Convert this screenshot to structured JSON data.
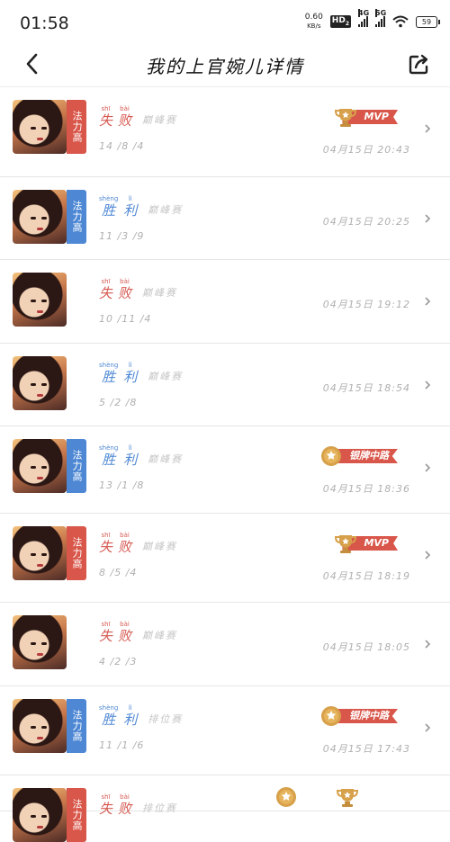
{
  "status_bar": {
    "time": "01:58",
    "net_speed_value": "0.60",
    "net_speed_unit": "KB/s",
    "hd": "HD",
    "hd_sub": "2",
    "sig1": "4G",
    "sig2": "5G",
    "battery": "59"
  },
  "nav": {
    "title": "我的上官婉儿详情"
  },
  "rows": [
    {
      "hero_tag": "法力高",
      "tag_color": "red",
      "result": [
        "失",
        "败"
      ],
      "result_py": [
        "shī",
        "bài"
      ],
      "result_type": "loss",
      "mode": "巅峰赛",
      "kda": "14 /8 /4",
      "time": "04月15日 20:43",
      "badge": "MVP",
      "badge_kind": "mvp"
    },
    {
      "hero_tag": "法力高",
      "tag_color": "blue",
      "result": [
        "胜",
        "利"
      ],
      "result_py": [
        "shèng",
        "lì"
      ],
      "result_type": "win",
      "mode": "巅峰赛",
      "kda": "11 /3 /9",
      "time": "04月15日 20:25",
      "badge": "",
      "badge_kind": ""
    },
    {
      "hero_tag": "",
      "tag_color": "",
      "result": [
        "失",
        "败"
      ],
      "result_py": [
        "shī",
        "bài"
      ],
      "result_type": "loss",
      "mode": "巅峰赛",
      "kda": "10 /11 /4",
      "time": "04月15日 19:12",
      "badge": "",
      "badge_kind": ""
    },
    {
      "hero_tag": "",
      "tag_color": "",
      "result": [
        "胜",
        "利"
      ],
      "result_py": [
        "shèng",
        "lì"
      ],
      "result_type": "win",
      "mode": "巅峰赛",
      "kda": "5 /2 /8",
      "time": "04月15日 18:54",
      "badge": "",
      "badge_kind": ""
    },
    {
      "hero_tag": "法力高",
      "tag_color": "blue",
      "result": [
        "胜",
        "利"
      ],
      "result_py": [
        "shèng",
        "lì"
      ],
      "result_type": "win",
      "mode": "巅峰赛",
      "kda": "13 /1 /8",
      "time": "04月15日 18:36",
      "badge": "银牌中路",
      "badge_kind": "silver"
    },
    {
      "hero_tag": "法力高",
      "tag_color": "red",
      "result": [
        "失",
        "败"
      ],
      "result_py": [
        "shī",
        "bài"
      ],
      "result_type": "loss",
      "mode": "巅峰赛",
      "kda": "8 /5 /4",
      "time": "04月15日 18:19",
      "badge": "MVP",
      "badge_kind": "mvp"
    },
    {
      "hero_tag": "",
      "tag_color": "",
      "result": [
        "失",
        "败"
      ],
      "result_py": [
        "shī",
        "bài"
      ],
      "result_type": "loss",
      "mode": "巅峰赛",
      "kda": "4 /2 /3",
      "time": "04月15日 18:05",
      "badge": "",
      "badge_kind": ""
    },
    {
      "hero_tag": "法力高",
      "tag_color": "blue",
      "result": [
        "胜",
        "利"
      ],
      "result_py": [
        "shèng",
        "lì"
      ],
      "result_type": "win",
      "mode": "排位赛",
      "kda": "11 /1 /6",
      "time": "04月15日 17:43",
      "badge": "银牌中路",
      "badge_kind": "silver"
    },
    {
      "hero_tag": "法力高",
      "tag_color": "red",
      "result": [
        "失",
        "败"
      ],
      "result_py": [
        "shī",
        "bài"
      ],
      "result_type": "loss",
      "mode": "排位赛",
      "kda": "",
      "time": "",
      "badge": "",
      "badge_kind": ""
    }
  ],
  "colors": {
    "loss": "#d65a52",
    "win": "#4e88d4",
    "tag_red": "#d9564a",
    "tag_blue": "#4e88d4",
    "ribbon": "#d9564a"
  }
}
